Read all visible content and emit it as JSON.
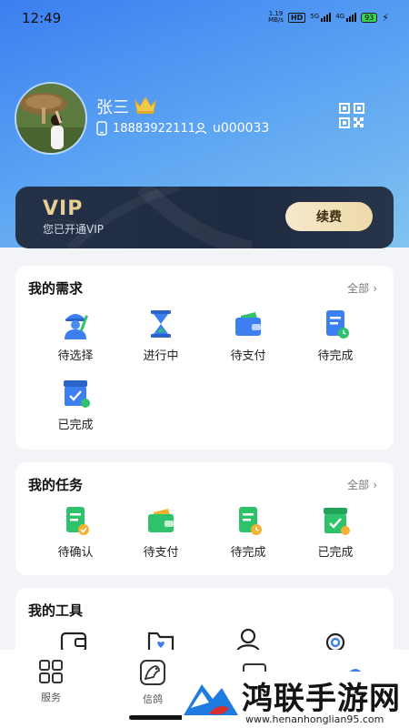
{
  "status": {
    "time": "12:49",
    "net_top": "1.19",
    "net_bottom": "MB/s",
    "hd": "HD",
    "sig1": "5G",
    "sig2": "4G",
    "battery": "93"
  },
  "profile": {
    "name": "张三",
    "phone": "18883922111",
    "uid": "u000033"
  },
  "vip": {
    "title": "VIP",
    "subtitle": "您已开通VIP",
    "renew_label": "续费"
  },
  "demands": {
    "title": "我的需求",
    "all": "全部",
    "items": [
      {
        "label": "待选择",
        "icon": "worker-icon"
      },
      {
        "label": "进行中",
        "icon": "hourglass-icon"
      },
      {
        "label": "待支付",
        "icon": "wallet-icon"
      },
      {
        "label": "待完成",
        "icon": "document-clock-icon"
      },
      {
        "label": "已完成",
        "icon": "box-check-icon"
      }
    ]
  },
  "tasks": {
    "title": "我的任务",
    "all": "全部",
    "items": [
      {
        "label": "待确认",
        "icon": "document-check-icon"
      },
      {
        "label": "待支付",
        "icon": "wallet-icon"
      },
      {
        "label": "待完成",
        "icon": "document-clock-icon"
      },
      {
        "label": "已完成",
        "icon": "box-check-icon"
      }
    ]
  },
  "tools": {
    "title": "我的工具",
    "icons": [
      "wallet-outline-icon",
      "folder-heart-icon",
      "person-icon",
      "gear-icon"
    ]
  },
  "tabbar": {
    "items": [
      {
        "label": "服务",
        "icon": "grid-icon"
      },
      {
        "label": "信鸽",
        "icon": "pigeon-icon"
      }
    ]
  },
  "watermark": {
    "text": "鸿联手游网",
    "url": "www.henanhonglian95.com"
  },
  "colors": {
    "header_start": "#3b7ff0",
    "header_end": "#86c8ef",
    "primary_blue": "#3d7ef0",
    "green": "#2ec26a",
    "gold": "#e9cf95",
    "vip_bg": "#243147"
  }
}
